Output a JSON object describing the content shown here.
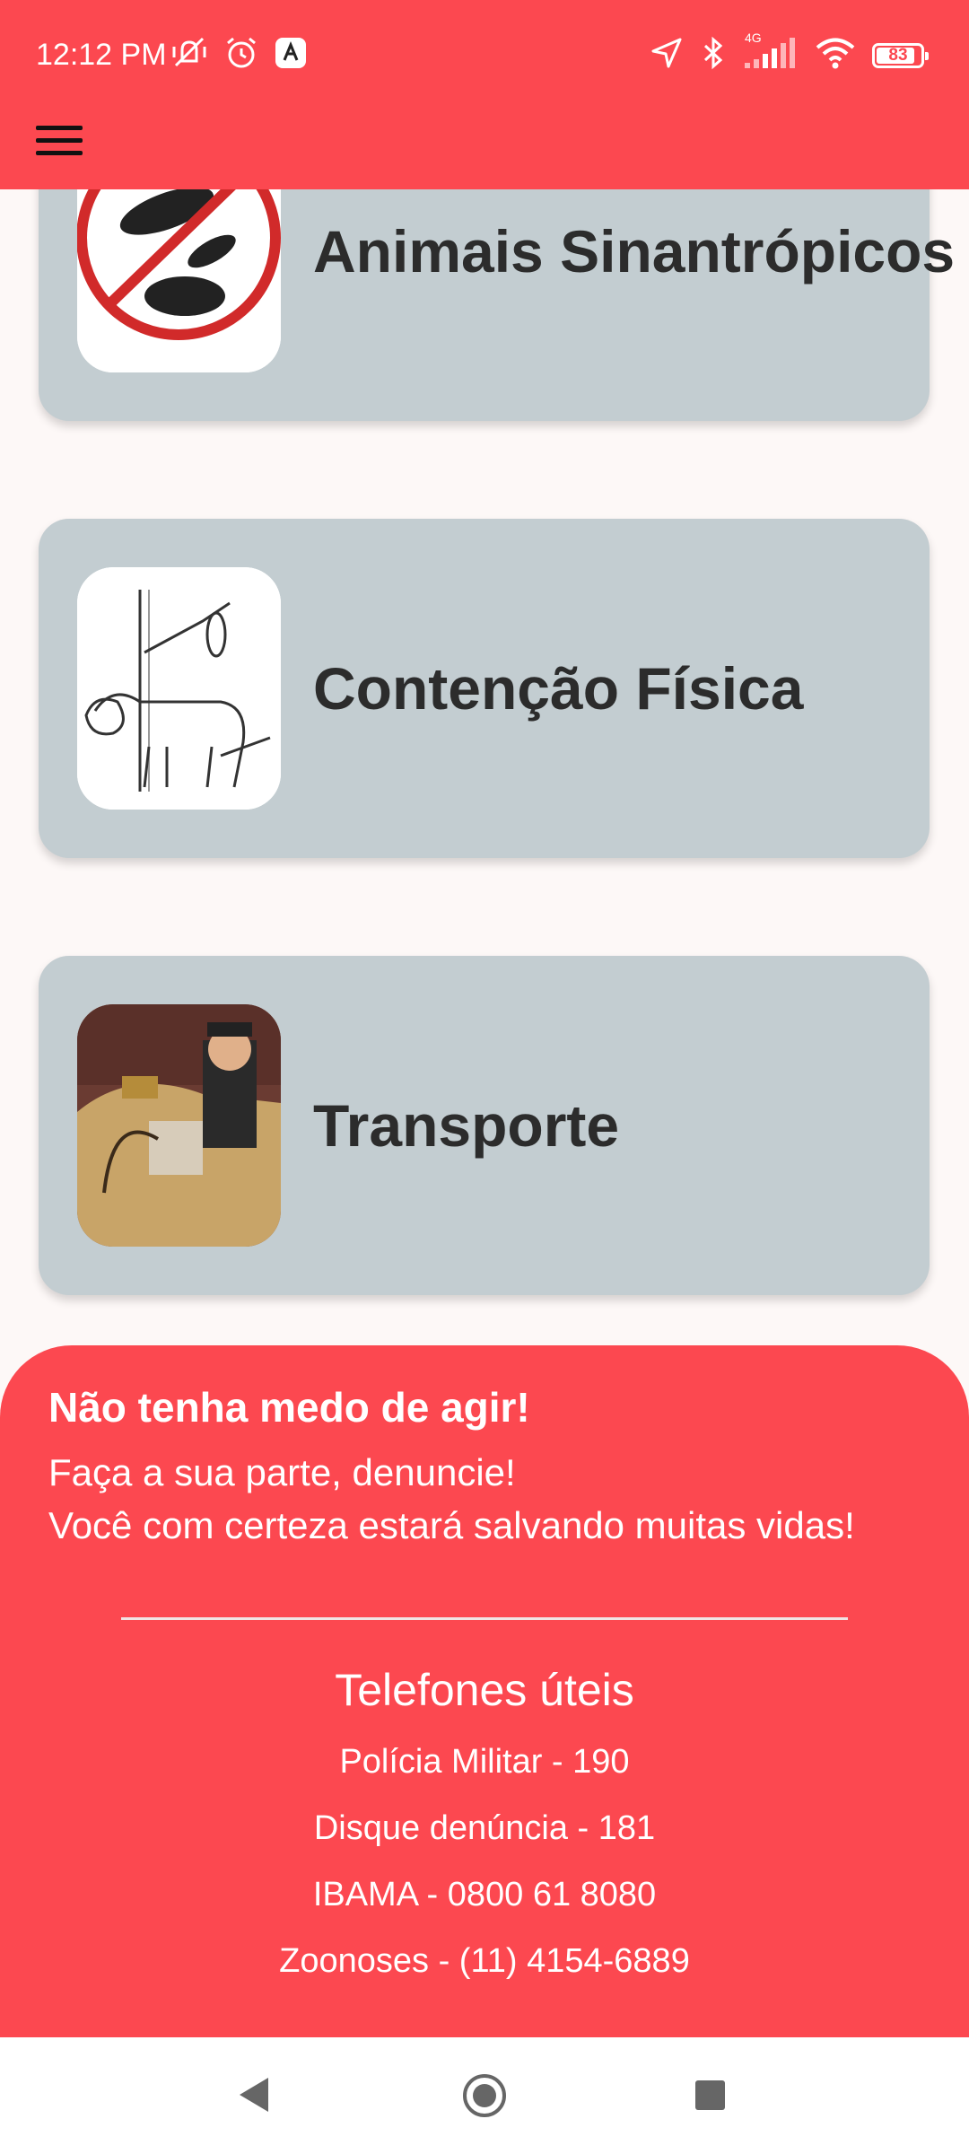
{
  "status_bar": {
    "time": "12:12 PM",
    "network": "4G",
    "battery": "83",
    "icons": [
      "mute-vibrate-icon",
      "alarm-icon",
      "app-notification-icon",
      "location-icon",
      "bluetooth-icon",
      "signal-icon",
      "wifi-icon",
      "battery-icon"
    ]
  },
  "app_bar": {
    "menu_icon": "hamburger-menu-icon"
  },
  "cards": [
    {
      "label": "Animais Sinantrópicos",
      "image": "no-pests-illustration"
    },
    {
      "label": "Contenção Física",
      "image": "dog-restraint-illustration"
    },
    {
      "label": "Transporte",
      "image": "animal-trafficking-illustration"
    }
  ],
  "footer": {
    "headline": "Não tenha medo de agir!",
    "line1": "Faça a sua parte, denuncie!",
    "line2": "Você com certeza estará salvando muitas vidas!",
    "phones_title": "Telefones úteis",
    "phones": [
      "Polícia Militar - 190",
      "Disque denúncia - 181",
      "IBAMA - 0800 61 8080",
      "Zoonoses - (11) 4154-6889"
    ]
  },
  "nav_bar": {
    "icons": [
      "back-icon",
      "home-icon",
      "recents-icon"
    ]
  },
  "colors": {
    "accent": "#fc4850",
    "card": "#c3cdd1",
    "background": "#fdf8f7"
  }
}
